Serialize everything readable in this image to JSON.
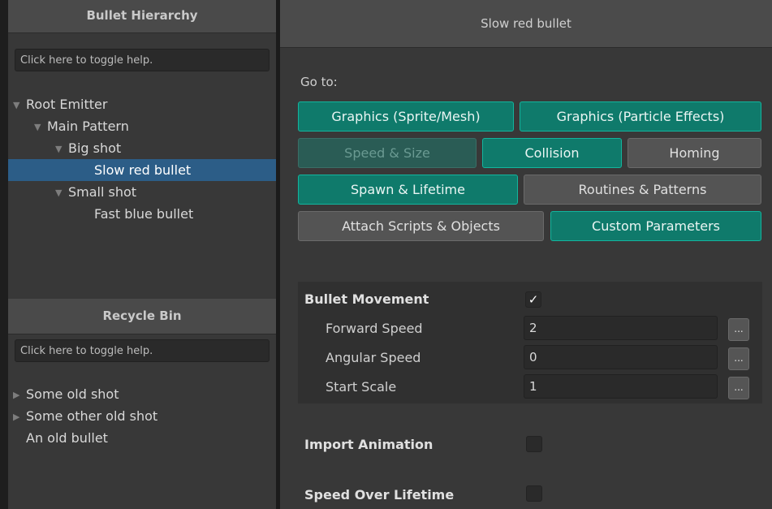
{
  "hierarchy": {
    "title": "Bullet Hierarchy",
    "help": "Click here to toggle help.",
    "items": [
      {
        "label": "Root Emitter",
        "arrow": "▼"
      },
      {
        "label": "Main Pattern",
        "arrow": "▼"
      },
      {
        "label": "Big shot",
        "arrow": "▼"
      },
      {
        "label": "Slow red bullet",
        "arrow": ""
      },
      {
        "label": "Small shot",
        "arrow": "▼"
      },
      {
        "label": "Fast blue bullet",
        "arrow": ""
      }
    ]
  },
  "recycle": {
    "title": "Recycle Bin",
    "help": "Click here to toggle help.",
    "items": [
      {
        "label": "Some old shot",
        "arrow": "▶"
      },
      {
        "label": "Some other old shot",
        "arrow": "▶"
      },
      {
        "label": "An old bullet",
        "arrow": ""
      }
    ]
  },
  "inspector": {
    "title": "Slow red bullet",
    "goto": "Go to:",
    "buttons": {
      "graphics_sprite": "Graphics (Sprite/Mesh)",
      "graphics_particle": "Graphics (Particle Effects)",
      "speed_size": "Speed & Size",
      "collision": "Collision",
      "homing": "Homing",
      "spawn": "Spawn & Lifetime",
      "routines": "Routines & Patterns",
      "attach": "Attach Scripts & Objects",
      "custom": "Custom Parameters"
    },
    "movement": {
      "title": "Bullet Movement",
      "checked": "✓",
      "forward_label": "Forward Speed",
      "forward_value": "2",
      "angular_label": "Angular Speed",
      "angular_value": "0",
      "scale_label": "Start Scale",
      "scale_value": "1",
      "dots": "..."
    },
    "import_animation": "Import Animation",
    "speed_over_lifetime": "Speed Over Lifetime"
  },
  "colors": {
    "accent_teal": "#0f7a6b",
    "selection": "#2c5d87",
    "panel": "#383838"
  }
}
